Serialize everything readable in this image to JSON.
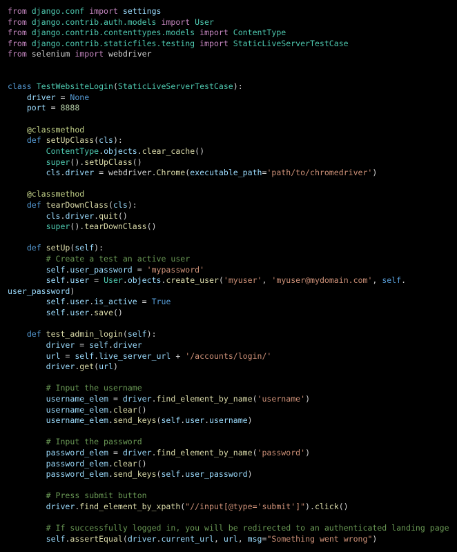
{
  "editor": {
    "language": "python",
    "colors": {
      "background": "#000000",
      "kw": "#c586c0",
      "kb": "#569cd6",
      "cls": "#4ec9b0",
      "fn": "#dcdcaa",
      "var": "#9cdcfe",
      "str": "#ce9178",
      "num": "#b5cea8",
      "com": "#6a9955",
      "dec": "#c5d48a",
      "pl": "#d4d4d4"
    },
    "lines": [
      [
        [
          "kw",
          "from"
        ],
        [
          "pl",
          " "
        ],
        [
          "cls",
          "django.conf"
        ],
        [
          "pl",
          " "
        ],
        [
          "kw",
          "import"
        ],
        [
          "pl",
          " "
        ],
        [
          "var",
          "settings"
        ]
      ],
      [
        [
          "kw",
          "from"
        ],
        [
          "pl",
          " "
        ],
        [
          "cls",
          "django.contrib.auth.models"
        ],
        [
          "pl",
          " "
        ],
        [
          "kw",
          "import"
        ],
        [
          "pl",
          " "
        ],
        [
          "cls",
          "User"
        ]
      ],
      [
        [
          "kw",
          "from"
        ],
        [
          "pl",
          " "
        ],
        [
          "cls",
          "django.contrib.contenttypes.models"
        ],
        [
          "pl",
          " "
        ],
        [
          "kw",
          "import"
        ],
        [
          "pl",
          " "
        ],
        [
          "cls",
          "ContentType"
        ]
      ],
      [
        [
          "kw",
          "from"
        ],
        [
          "pl",
          " "
        ],
        [
          "cls",
          "django.contrib.staticfiles.testing"
        ],
        [
          "pl",
          " "
        ],
        [
          "kw",
          "import"
        ],
        [
          "pl",
          " "
        ],
        [
          "cls",
          "StaticLiveServerTestCase"
        ]
      ],
      [
        [
          "kw",
          "from"
        ],
        [
          "pl",
          " selenium "
        ],
        [
          "kw",
          "import"
        ],
        [
          "pl",
          " webdriver"
        ]
      ],
      [],
      [],
      [
        [
          "kb",
          "class"
        ],
        [
          "pl",
          " "
        ],
        [
          "cls",
          "TestWebsiteLogin"
        ],
        [
          "pl",
          "("
        ],
        [
          "cls",
          "StaticLiveServerTestCase"
        ],
        [
          "pl",
          "):"
        ]
      ],
      [
        [
          "pl",
          "    "
        ],
        [
          "var",
          "driver"
        ],
        [
          "pl",
          " = "
        ],
        [
          "kb",
          "None"
        ]
      ],
      [
        [
          "pl",
          "    "
        ],
        [
          "var",
          "port"
        ],
        [
          "pl",
          " = "
        ],
        [
          "num",
          "8888"
        ]
      ],
      [],
      [
        [
          "pl",
          "    "
        ],
        [
          "dec",
          "@classmethod"
        ]
      ],
      [
        [
          "pl",
          "    "
        ],
        [
          "kb",
          "def"
        ],
        [
          "pl",
          " "
        ],
        [
          "fn",
          "setUpClass"
        ],
        [
          "pl",
          "("
        ],
        [
          "var",
          "cls"
        ],
        [
          "pl",
          "):"
        ]
      ],
      [
        [
          "pl",
          "        "
        ],
        [
          "cls",
          "ContentType"
        ],
        [
          "pl",
          "."
        ],
        [
          "var",
          "objects"
        ],
        [
          "pl",
          "."
        ],
        [
          "fn",
          "clear_cache"
        ],
        [
          "pl",
          "()"
        ]
      ],
      [
        [
          "pl",
          "        "
        ],
        [
          "cls",
          "super"
        ],
        [
          "pl",
          "()."
        ],
        [
          "fn",
          "setUpClass"
        ],
        [
          "pl",
          "()"
        ]
      ],
      [
        [
          "pl",
          "        "
        ],
        [
          "var",
          "cls"
        ],
        [
          "pl",
          "."
        ],
        [
          "var",
          "driver"
        ],
        [
          "pl",
          " = webdriver."
        ],
        [
          "fn",
          "Chrome"
        ],
        [
          "pl",
          "("
        ],
        [
          "var",
          "executable_path"
        ],
        [
          "pl",
          "="
        ],
        [
          "str",
          "'path/to/chromedriver'"
        ],
        [
          "pl",
          ")"
        ]
      ],
      [],
      [
        [
          "pl",
          "    "
        ],
        [
          "dec",
          "@classmethod"
        ]
      ],
      [
        [
          "pl",
          "    "
        ],
        [
          "kb",
          "def"
        ],
        [
          "pl",
          " "
        ],
        [
          "fn",
          "tearDownClass"
        ],
        [
          "pl",
          "("
        ],
        [
          "var",
          "cls"
        ],
        [
          "pl",
          "):"
        ]
      ],
      [
        [
          "pl",
          "        "
        ],
        [
          "var",
          "cls"
        ],
        [
          "pl",
          "."
        ],
        [
          "var",
          "driver"
        ],
        [
          "pl",
          "."
        ],
        [
          "fn",
          "quit"
        ],
        [
          "pl",
          "()"
        ]
      ],
      [
        [
          "pl",
          "        "
        ],
        [
          "cls",
          "super"
        ],
        [
          "pl",
          "()."
        ],
        [
          "fn",
          "tearDownClass"
        ],
        [
          "pl",
          "()"
        ]
      ],
      [],
      [
        [
          "pl",
          "    "
        ],
        [
          "kb",
          "def"
        ],
        [
          "pl",
          " "
        ],
        [
          "fn",
          "setUp"
        ],
        [
          "pl",
          "("
        ],
        [
          "var",
          "self"
        ],
        [
          "pl",
          "):"
        ]
      ],
      [
        [
          "pl",
          "        "
        ],
        [
          "com",
          "# Create a test an active user"
        ]
      ],
      [
        [
          "pl",
          "        "
        ],
        [
          "var",
          "self"
        ],
        [
          "pl",
          "."
        ],
        [
          "var",
          "user_password"
        ],
        [
          "pl",
          " = "
        ],
        [
          "str",
          "'mypassword'"
        ]
      ],
      [
        [
          "pl",
          "        "
        ],
        [
          "var",
          "self"
        ],
        [
          "pl",
          "."
        ],
        [
          "var",
          "user"
        ],
        [
          "pl",
          " = "
        ],
        [
          "cls",
          "User"
        ],
        [
          "pl",
          "."
        ],
        [
          "var",
          "objects"
        ],
        [
          "pl",
          "."
        ],
        [
          "fn",
          "create_user"
        ],
        [
          "pl",
          "("
        ],
        [
          "str",
          "'myuser'"
        ],
        [
          "pl",
          ", "
        ],
        [
          "str",
          "'myuser@mydomain.com'"
        ],
        [
          "pl",
          ", "
        ],
        [
          "kb",
          "self"
        ],
        [
          "pl",
          "."
        ]
      ],
      [
        [
          "var",
          "user_password"
        ],
        [
          "pl",
          ")"
        ]
      ],
      [
        [
          "pl",
          "        "
        ],
        [
          "var",
          "self"
        ],
        [
          "pl",
          "."
        ],
        [
          "var",
          "user"
        ],
        [
          "pl",
          "."
        ],
        [
          "var",
          "is_active"
        ],
        [
          "pl",
          " = "
        ],
        [
          "kb",
          "True"
        ]
      ],
      [
        [
          "pl",
          "        "
        ],
        [
          "var",
          "self"
        ],
        [
          "pl",
          "."
        ],
        [
          "var",
          "user"
        ],
        [
          "pl",
          "."
        ],
        [
          "fn",
          "save"
        ],
        [
          "pl",
          "()"
        ]
      ],
      [],
      [
        [
          "pl",
          "    "
        ],
        [
          "kb",
          "def"
        ],
        [
          "pl",
          " "
        ],
        [
          "fn",
          "test_admin_login"
        ],
        [
          "pl",
          "("
        ],
        [
          "var",
          "self"
        ],
        [
          "pl",
          "):"
        ]
      ],
      [
        [
          "pl",
          "        "
        ],
        [
          "var",
          "driver"
        ],
        [
          "pl",
          " = "
        ],
        [
          "var",
          "self"
        ],
        [
          "pl",
          "."
        ],
        [
          "var",
          "driver"
        ]
      ],
      [
        [
          "pl",
          "        "
        ],
        [
          "var",
          "url"
        ],
        [
          "pl",
          " = "
        ],
        [
          "var",
          "self"
        ],
        [
          "pl",
          "."
        ],
        [
          "var",
          "live_server_url"
        ],
        [
          "pl",
          " + "
        ],
        [
          "str",
          "'/accounts/login/'"
        ]
      ],
      [
        [
          "pl",
          "        "
        ],
        [
          "var",
          "driver"
        ],
        [
          "pl",
          "."
        ],
        [
          "fn",
          "get"
        ],
        [
          "pl",
          "("
        ],
        [
          "var",
          "url"
        ],
        [
          "pl",
          ")"
        ]
      ],
      [],
      [
        [
          "pl",
          "        "
        ],
        [
          "com",
          "# Input the username"
        ]
      ],
      [
        [
          "pl",
          "        "
        ],
        [
          "var",
          "username_elem"
        ],
        [
          "pl",
          " = "
        ],
        [
          "var",
          "driver"
        ],
        [
          "pl",
          "."
        ],
        [
          "fn",
          "find_element_by_name"
        ],
        [
          "pl",
          "("
        ],
        [
          "str",
          "'username'"
        ],
        [
          "pl",
          ")"
        ]
      ],
      [
        [
          "pl",
          "        "
        ],
        [
          "var",
          "username_elem"
        ],
        [
          "pl",
          "."
        ],
        [
          "fn",
          "clear"
        ],
        [
          "pl",
          "()"
        ]
      ],
      [
        [
          "pl",
          "        "
        ],
        [
          "var",
          "username_elem"
        ],
        [
          "pl",
          "."
        ],
        [
          "fn",
          "send_keys"
        ],
        [
          "pl",
          "("
        ],
        [
          "var",
          "self"
        ],
        [
          "pl",
          "."
        ],
        [
          "var",
          "user"
        ],
        [
          "pl",
          "."
        ],
        [
          "var",
          "username"
        ],
        [
          "pl",
          ")"
        ]
      ],
      [],
      [
        [
          "pl",
          "        "
        ],
        [
          "com",
          "# Input the password"
        ]
      ],
      [
        [
          "pl",
          "        "
        ],
        [
          "var",
          "password_elem"
        ],
        [
          "pl",
          " = "
        ],
        [
          "var",
          "driver"
        ],
        [
          "pl",
          "."
        ],
        [
          "fn",
          "find_element_by_name"
        ],
        [
          "pl",
          "("
        ],
        [
          "str",
          "'password'"
        ],
        [
          "pl",
          ")"
        ]
      ],
      [
        [
          "pl",
          "        "
        ],
        [
          "var",
          "password_elem"
        ],
        [
          "pl",
          "."
        ],
        [
          "fn",
          "clear"
        ],
        [
          "pl",
          "()"
        ]
      ],
      [
        [
          "pl",
          "        "
        ],
        [
          "var",
          "password_elem"
        ],
        [
          "pl",
          "."
        ],
        [
          "fn",
          "send_keys"
        ],
        [
          "pl",
          "("
        ],
        [
          "var",
          "self"
        ],
        [
          "pl",
          "."
        ],
        [
          "var",
          "user_password"
        ],
        [
          "pl",
          ")"
        ]
      ],
      [],
      [
        [
          "pl",
          "        "
        ],
        [
          "com",
          "# Press submit button"
        ]
      ],
      [
        [
          "pl",
          "        "
        ],
        [
          "var",
          "driver"
        ],
        [
          "pl",
          "."
        ],
        [
          "fn",
          "find_element_by_xpath"
        ],
        [
          "pl",
          "("
        ],
        [
          "str",
          "\"//input[@type='submit']\""
        ],
        [
          "pl",
          ")."
        ],
        [
          "fn",
          "click"
        ],
        [
          "pl",
          "()"
        ]
      ],
      [],
      [
        [
          "pl",
          "        "
        ],
        [
          "com",
          "# If successfully logged in, you will be redirected to an authenticated landing page"
        ]
      ],
      [
        [
          "pl",
          "        "
        ],
        [
          "var",
          "self"
        ],
        [
          "pl",
          "."
        ],
        [
          "fn",
          "assertEqual"
        ],
        [
          "pl",
          "("
        ],
        [
          "var",
          "driver"
        ],
        [
          "pl",
          "."
        ],
        [
          "var",
          "current_url"
        ],
        [
          "pl",
          ", "
        ],
        [
          "var",
          "url"
        ],
        [
          "pl",
          ", "
        ],
        [
          "var",
          "msg"
        ],
        [
          "pl",
          "="
        ],
        [
          "str",
          "\"Something went wrong\""
        ],
        [
          "pl",
          ")"
        ]
      ]
    ]
  }
}
